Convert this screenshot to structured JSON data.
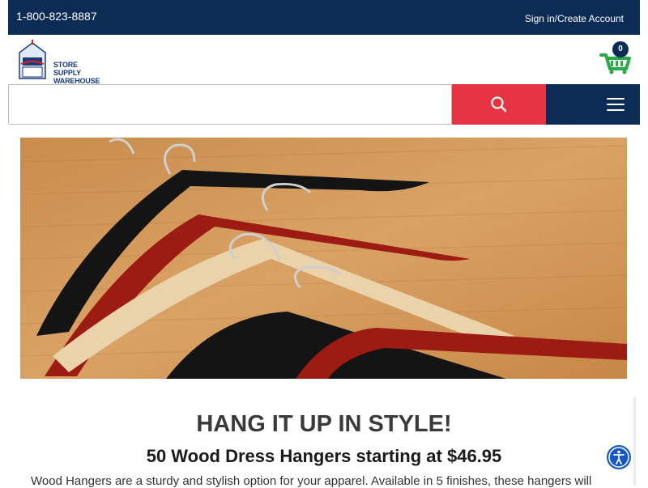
{
  "header": {
    "phone": "1-800-823-8887",
    "signin_label": "Sign in/Create Account"
  },
  "logo": {
    "line1": "STORE SUPPLY",
    "line2": "WAREHOUSE",
    "icon": "store-supply-warehouse-logo"
  },
  "cart": {
    "count": "0",
    "icon": "shopping-cart-icon"
  },
  "search": {
    "value": "",
    "placeholder": "",
    "button_icon": "search-icon"
  },
  "menu": {
    "icon": "hamburger-menu-icon"
  },
  "hero": {
    "image": "wood-hangers-photo"
  },
  "content": {
    "headline": "HANG IT UP IN STYLE!",
    "subhead": "50 Wood Dress Hangers starting at $46.95",
    "body": "Wood Hangers are a sturdy and stylish option for your apparel. Available in 5 finishes, these hangers will"
  },
  "colors": {
    "navy": "#0c2b55",
    "red": "#e63442",
    "green": "#2aa84a",
    "accessibility_blue": "#1657c6"
  },
  "accessibility": {
    "icon": "accessibility-icon"
  }
}
